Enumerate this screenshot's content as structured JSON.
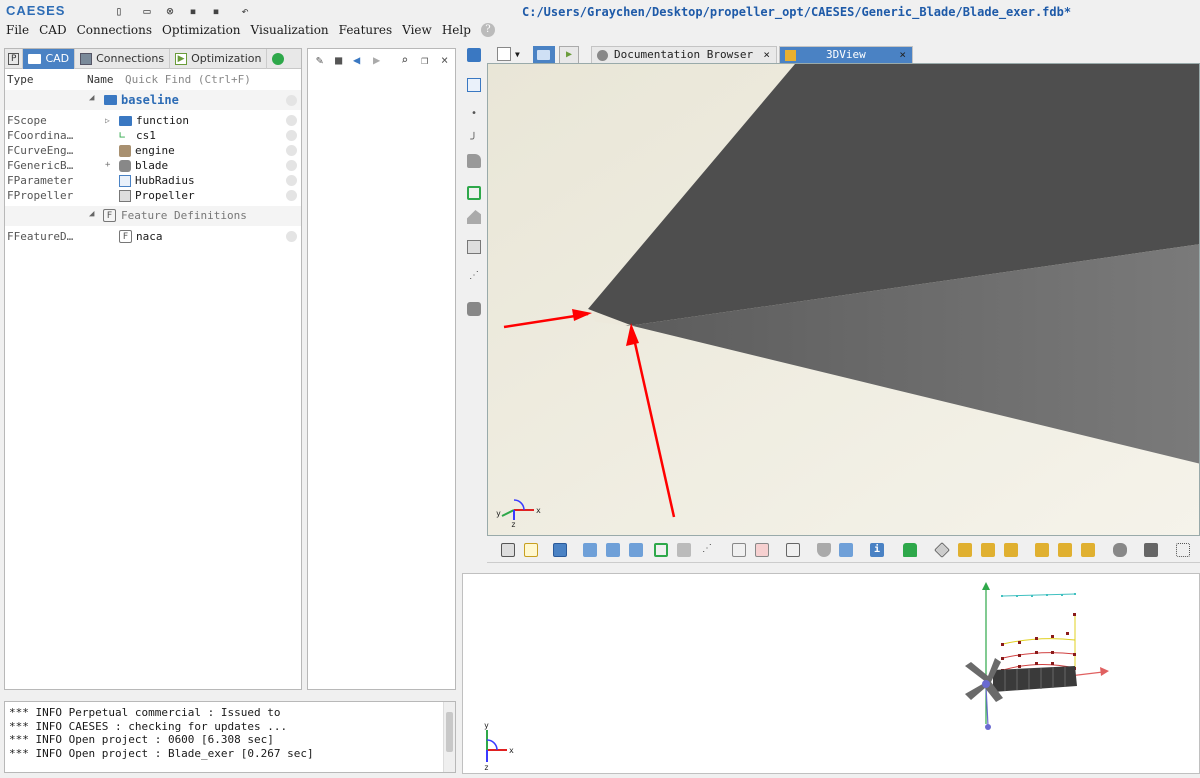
{
  "app": {
    "logo": "CAESES",
    "title": "C:/Users/Graychen/Desktop/propeller_opt/CAESES/Generic_Blade/Blade_exer.fdb*"
  },
  "menu": [
    "File",
    "CAD",
    "Connections",
    "Optimization",
    "Visualization",
    "Features",
    "View",
    "Help"
  ],
  "left_panel": {
    "tabs": {
      "p": "P",
      "cad": "CAD",
      "connections": "Connections",
      "optimization": "Optimization"
    },
    "header": {
      "type": "Type",
      "name": "Name",
      "quick_find": "Quick Find (Ctrl+F)"
    },
    "baseline_group": "baseline",
    "rows": [
      {
        "type": "FScope",
        "name": "function"
      },
      {
        "type": "FCoordina…",
        "name": "cs1"
      },
      {
        "type": "FCurveEng…",
        "name": "engine"
      },
      {
        "type": "FGenericB…",
        "name": "blade"
      },
      {
        "type": "FParameter",
        "name": "HubRadius"
      },
      {
        "type": "FPropeller",
        "name": "Propeller"
      }
    ],
    "feature_group": "Feature Definitions",
    "feature_rows": [
      {
        "type": "FFeatureD…",
        "name": "naca"
      }
    ]
  },
  "console": {
    "lines": [
      "*** INFO Perpetual commercial  : Issued to",
      "*** INFO CAESES : checking for updates ...",
      "*** INFO Open project : 0600 [6.308 sec]",
      "*** INFO Open project : Blade_exer [0.267 sec]"
    ]
  },
  "view_tabs": {
    "doc": "Documentation Browser",
    "view3d": "3DView"
  },
  "axes": {
    "x": "x",
    "y": "y",
    "z": "z"
  },
  "colors": {
    "accent": "#4a82c4",
    "view_bg": "#ede9dc",
    "blade_dark": "#4e4e4e",
    "blade_mid": "#6c6c6c",
    "arrow": "#ff0000"
  }
}
